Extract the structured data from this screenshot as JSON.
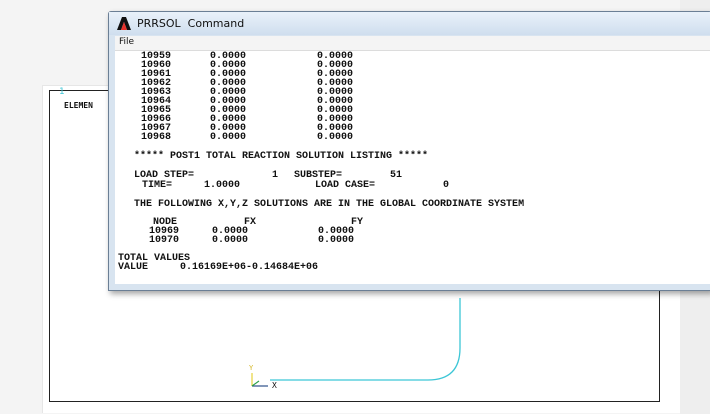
{
  "window": {
    "title": "PRRSOL  Command",
    "menu": [
      "File"
    ]
  },
  "background": {
    "frame_number": "1",
    "element_label": "ELEMEN",
    "triad": {
      "y_label": "Y",
      "x_label": "X"
    },
    "accent_color": "#3cc6d6"
  },
  "listing": {
    "rows": [
      {
        "node": "10959",
        "ux": "0.0000",
        "uy": "0.0000"
      },
      {
        "node": "10960",
        "ux": "0.0000",
        "uy": "0.0000"
      },
      {
        "node": "10961",
        "ux": "0.0000",
        "uy": "0.0000"
      },
      {
        "node": "10962",
        "ux": "0.0000",
        "uy": "0.0000"
      },
      {
        "node": "10963",
        "ux": "0.0000",
        "uy": "0.0000"
      },
      {
        "node": "10964",
        "ux": "0.0000",
        "uy": "0.0000"
      },
      {
        "node": "10965",
        "ux": "0.0000",
        "uy": "0.0000"
      },
      {
        "node": "10966",
        "ux": "0.0000",
        "uy": "0.0000"
      },
      {
        "node": "10967",
        "ux": "0.0000",
        "uy": "0.0000"
      },
      {
        "node": "10968",
        "ux": "0.0000",
        "uy": "0.0000"
      }
    ],
    "heading": "***** POST1 TOTAL REACTION SOLUTION LISTING *****",
    "load_step_label": "LOAD STEP=",
    "load_step_value": "1",
    "substep_label": "SUBSTEP=",
    "substep_value": "51",
    "time_label": "TIME=",
    "time_value": "1.0000",
    "load_case_label": "LOAD CASE=",
    "load_case_value": "0",
    "coord_note": "THE FOLLOWING X,Y,Z SOLUTIONS ARE IN THE GLOBAL COORDINATE SYSTEM",
    "reaction_headers": [
      "NODE",
      "FX",
      "FY"
    ],
    "reaction_rows": [
      {
        "node": "10969",
        "fx": "0.0000",
        "fy": "0.0000"
      },
      {
        "node": "10970",
        "fx": "0.0000",
        "fy": "0.0000"
      }
    ],
    "total_label": "TOTAL VALUES",
    "value_label": "VALUE",
    "value_text": "0.16169E+06-0.14684E+06"
  }
}
